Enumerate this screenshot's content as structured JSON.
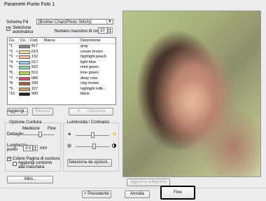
{
  "window": {
    "title": "Parametri Punto Foto 1"
  },
  "top": {
    "schema_label": "Schema Fili",
    "schema_value": "[Brother Chart(Photo Stitch)]",
    "auto_select_label": "Selezione automatica",
    "auto_select_checked": true,
    "max_colors_label": "Numero massimo di colori:",
    "max_colors_value": "10"
  },
  "table": {
    "headers": [
      "Co.",
      "Co.",
      "Cod.",
      "Marca",
      "Descrizione"
    ],
    "rows": [
      {
        "idx": "*1",
        "pin": "",
        "color": "#8c8c8c",
        "code": "817",
        "brand": "",
        "desc": "gray"
      },
      {
        "idx": "*2",
        "pin": "pin",
        "color": "#f4e1a6",
        "code": "010",
        "brand": "",
        "desc": "cream brown"
      },
      {
        "idx": "*3",
        "pin": "pin",
        "color": "#f4c39c",
        "code": "132",
        "brand": "",
        "desc": "highlight peach"
      },
      {
        "idx": "*4",
        "pin": "pin",
        "color": "#9cc8e9",
        "code": "017",
        "brand": "",
        "desc": "light blue"
      },
      {
        "idx": "*5",
        "pin": "",
        "color": "#8fd7a8",
        "code": "502",
        "brand": "",
        "desc": "mint green"
      },
      {
        "idx": "*6",
        "pin": "",
        "color": "#b6d95a",
        "code": "513",
        "brand": "",
        "desc": "lime green"
      },
      {
        "idx": "*7",
        "pin": "pin",
        "color": "#d94f6e",
        "code": "086",
        "brand": "",
        "desc": "deep rose"
      },
      {
        "idx": "*8",
        "pin": "",
        "color": "#a4603f",
        "code": "339",
        "brand": "",
        "desc": "clay brown"
      },
      {
        "idx": "*9",
        "pin": "",
        "color": "#c9a06a",
        "code": "157",
        "brand": "",
        "desc": "highlight milk..."
      },
      {
        "idx": "*10",
        "pin": "",
        "color": "#1a1a1a",
        "code": "900",
        "brand": "",
        "desc": "black"
      }
    ]
  },
  "table_buttons": {
    "add": "Aggiungi...",
    "remove": "Rimuovi",
    "keep": "Conserva"
  },
  "sewing": {
    "group_title": "Opzione Cucitura",
    "detail_label": "Dettaglio",
    "detail_left": "Mediocre",
    "detail_right": "Fine",
    "length_label": "Lunghezza punto",
    "length_value": "3.0",
    "length_unit": "mm",
    "sewing_page_color_label": "Colore Pagina di cucitura",
    "sewing_page_color_checked": true,
    "outline_label": "Aggiungi contorno alla maschera",
    "outline_checked": false,
    "other_button": "Altro..."
  },
  "brightness": {
    "group_title": "Luminosità / Contrasto",
    "options_button": "Seleziona da opzioni..."
  },
  "preview": {
    "update_button": "Aggiorna anteprima"
  },
  "footer": {
    "prev": "< Precedente",
    "cancel": "Annulla",
    "finish": "Fine"
  }
}
